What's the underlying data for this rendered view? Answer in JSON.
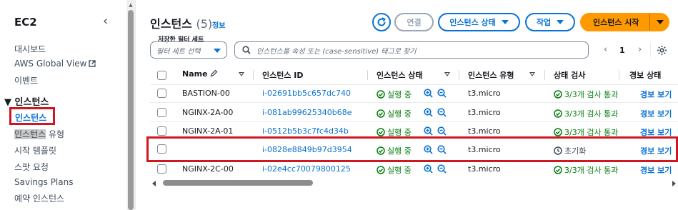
{
  "sidebar": {
    "title": "EC2",
    "items": [
      {
        "label": "대시보드"
      },
      {
        "label": "AWS Global View"
      },
      {
        "label": "이벤트"
      }
    ],
    "section_label": "인스턴스",
    "section_items": [
      {
        "label": "인스턴스",
        "active": true
      },
      {
        "label_hl": "인스턴스",
        "label_rest": " 유형"
      },
      {
        "label": "시작 템플릿"
      },
      {
        "label": "스팟 요청"
      },
      {
        "label": "Savings Plans"
      },
      {
        "label": "예약 인스턴스"
      }
    ]
  },
  "header": {
    "title": "인스턴스",
    "count": "(5)",
    "info": "정보",
    "buttons": {
      "connect": "연결",
      "state": "인스턴스 상태",
      "action": "작업",
      "launch": "인스턴스 시작"
    }
  },
  "filter": {
    "label": "저장한 필터 세트",
    "select_placeholder": "필터 세트 선택",
    "search_placeholder": "인스턴스을 속성 또는 (case-sensitive) 태그로 찾기",
    "page": "1"
  },
  "table": {
    "columns": [
      "Name",
      "인스턴스 ID",
      "인스턴스 상태",
      "인스턴스 유형",
      "상태 검사",
      "경보 상태"
    ],
    "rows": [
      {
        "name": "BASTION-00",
        "id": "i-02691bb5c657dc740",
        "state": "실행 중",
        "type": "t3.micro",
        "check": "3/3개 검사 통과",
        "alarm": "경보 보기"
      },
      {
        "name": "NGINX-2A-00",
        "id": "i-081ab99625340b68e",
        "state": "실행 중",
        "type": "t3.micro",
        "check": "3/3개 검사 통과",
        "alarm": "경보 보기"
      },
      {
        "name": "NGINX-2A-01",
        "id": "i-0512b5b3c7fc4d34b",
        "state": "실행 중",
        "type": "t3.micro",
        "check": "3/3개 검사 통과",
        "alarm": "경보 보기"
      },
      {
        "name": "",
        "id": "i-0828e8849b97d3954",
        "state": "실행 중",
        "type": "t3.micro",
        "check": "초기화",
        "alarm": "경보 보기"
      },
      {
        "name": "NGINX-2C-00",
        "id": "i-02e4cc70079800125",
        "state": "실행 중",
        "type": "t3.micro",
        "check": "3/3개 검사 통과",
        "alarm": "경보 보기"
      }
    ]
  },
  "colors": {
    "accent": "#0972d3",
    "launch": "#ff9900",
    "success": "#037f0c",
    "highlight_box": "#d0161f"
  }
}
